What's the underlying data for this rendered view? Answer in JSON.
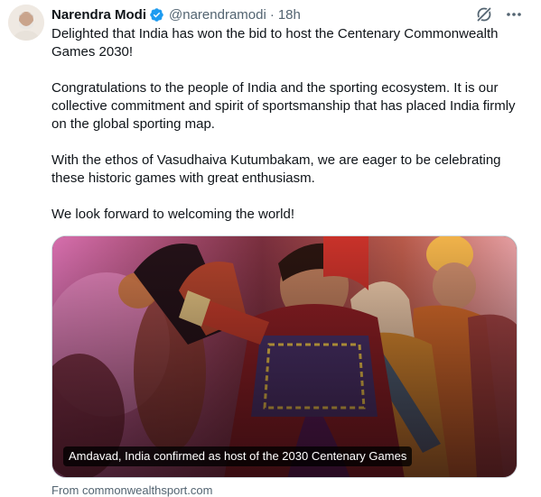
{
  "author": {
    "name": "Narendra Modi",
    "handle": "@narendramodi",
    "separator": "·",
    "time": "18h"
  },
  "icons": {
    "verified": "verified-badge-icon",
    "grok": "grok-icon",
    "more": "more-options-icon"
  },
  "colors": {
    "verified_blue": "#1d9bf0",
    "secondary_text": "#536471",
    "primary_text": "#0f1419"
  },
  "tweet": {
    "paragraphs": [
      "Delighted that India has won the bid to host the Centenary Commonwealth Games 2030!",
      "Congratulations to the people of India and the sporting ecosystem. It is our collective commitment and spirit of sportsmanship that has placed India firmly on the global sporting map.",
      "With the ethos of Vasudhaiva Kutumbakam, we are eager to be celebrating these historic games with great enthusiasm.",
      "We look forward to welcoming the world!"
    ]
  },
  "card": {
    "title": "Amdavad, India confirmed as host of the 2030 Centenary Games",
    "source": "From commonwealthsport.com"
  }
}
